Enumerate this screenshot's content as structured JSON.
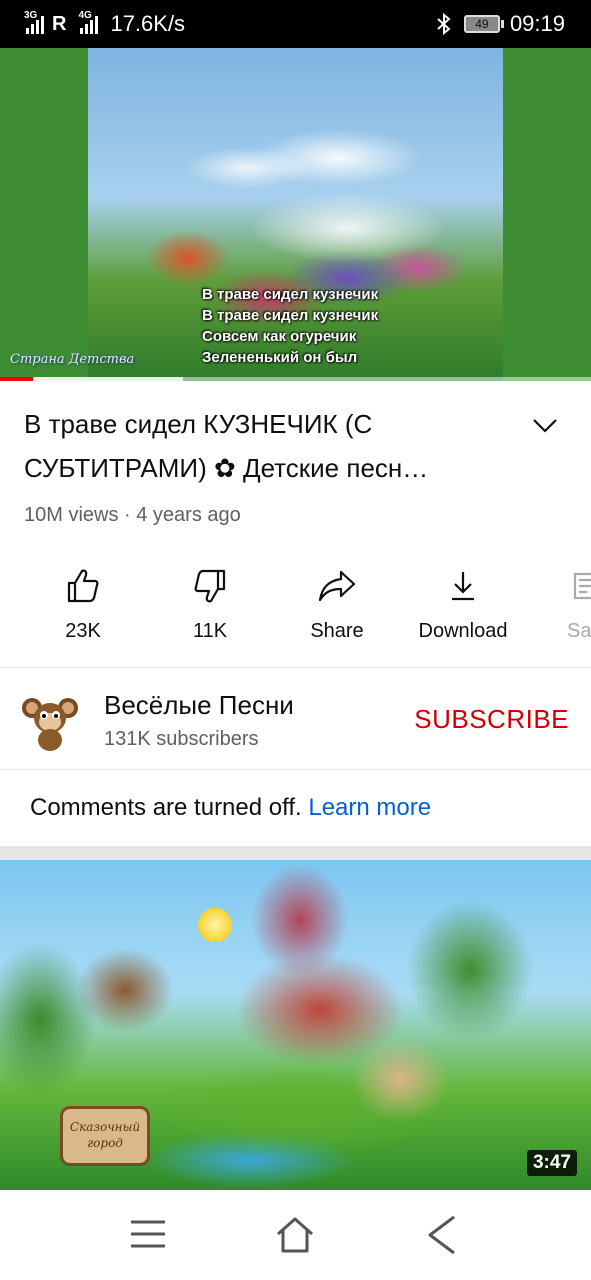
{
  "status_bar": {
    "network1": "3G",
    "roaming": "R",
    "network2": "4G",
    "speed": "17.6K/s",
    "battery": "49",
    "time": "09:19"
  },
  "player": {
    "lyrics": [
      "В траве сидел кузнечик",
      "В траве сидел кузнечик",
      "Совсем как огуречик",
      "Зелененький он был"
    ],
    "watermark": "Страна Детства",
    "progress_played": 0.055,
    "progress_buffered": 0.31
  },
  "video": {
    "title": "В траве сидел КУЗНЕЧИК (С СУБТИТРАМИ) ✿  Детские песн…",
    "meta": "10M views · 4 years ago"
  },
  "actions": {
    "like": "23K",
    "dislike": "11K",
    "share": "Share",
    "download": "Download",
    "save": "Sa"
  },
  "channel": {
    "name": "Весёлые Песни",
    "subscribers": "131K subscribers",
    "subscribe_label": "SUBSCRIBE"
  },
  "comments": {
    "text": "Comments are turned off.",
    "link": "Learn more"
  },
  "next_video": {
    "sign_line1": "Сказочный",
    "sign_line2": "город",
    "duration": "3:47"
  },
  "colors": {
    "accent_red": "#cc0000",
    "link_blue": "#065fd4",
    "progress_red": "#ff0000"
  },
  "icons": {
    "like": "thumbs-up-icon",
    "dislike": "thumbs-down-icon",
    "share": "share-icon",
    "download": "download-icon",
    "save": "save-icon",
    "expand": "chevron-down-icon",
    "nav_menu": "menu-icon",
    "nav_home": "home-icon",
    "nav_back": "back-icon"
  }
}
